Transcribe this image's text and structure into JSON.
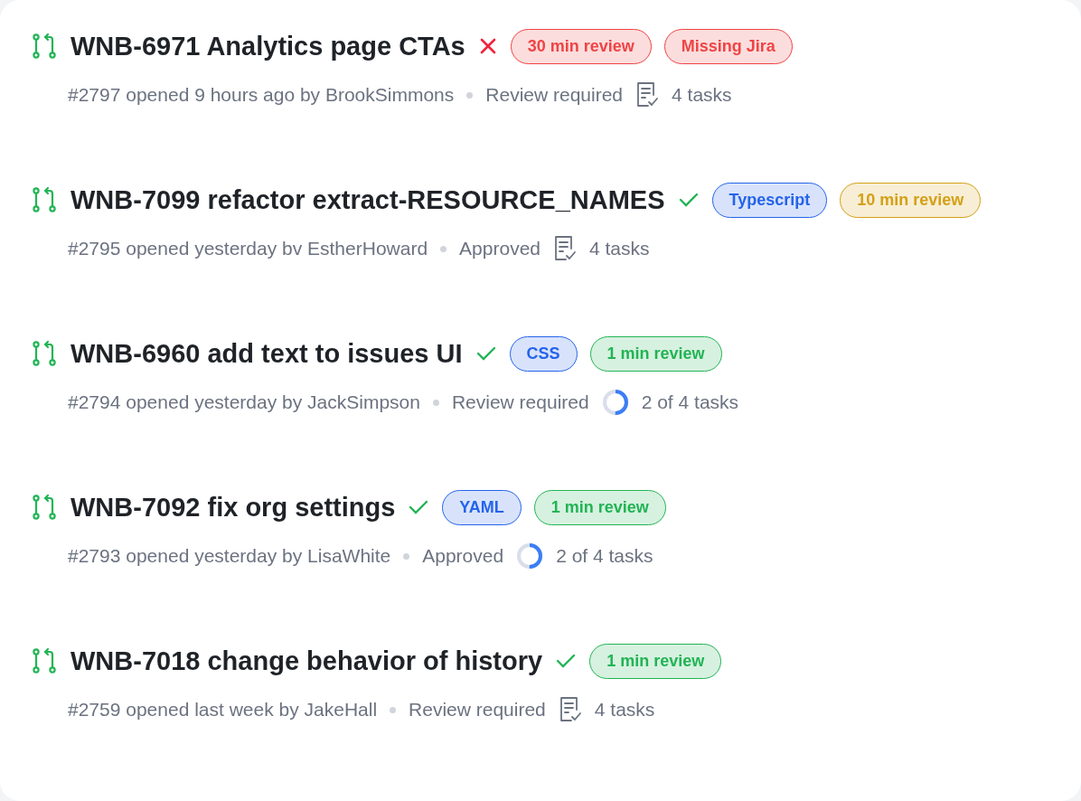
{
  "pull_requests": [
    {
      "title": "WNB-6971 Analytics page CTAs",
      "passed": false,
      "tags": [
        {
          "label": "30 min review",
          "color": "#ef4444"
        },
        {
          "label": "Missing Jira",
          "color": "#ef4444"
        }
      ],
      "meta": "#2797 opened 9 hours ago by BrookSimmons",
      "review": "Review required",
      "tasks": {
        "kind": "list",
        "label": "4 tasks"
      }
    },
    {
      "title": "WNB-7099 refactor extract-RESOURCE_NAMES",
      "passed": true,
      "tags": [
        {
          "label": "Typescript",
          "color": "#2563eb"
        },
        {
          "label": "10 min review",
          "color": "#d4a017"
        }
      ],
      "meta": "#2795 opened yesterday bv  EstherHoward",
      "review": "Approved",
      "tasks": {
        "kind": "list",
        "label": "4 tasks"
      }
    },
    {
      "title": "WNB-6960 add text to issues UI",
      "passed": true,
      "tags": [
        {
          "label": "CSS",
          "color": "#2563eb"
        },
        {
          "label": "1 min review",
          "color": "#22b455"
        }
      ],
      "meta": "#2794 opened yesterday by JackSimpson",
      "review": "Review required",
      "tasks": {
        "kind": "progress",
        "label": "2 of 4 tasks"
      }
    },
    {
      "title": "WNB-7092 fix org settings",
      "passed": true,
      "tags": [
        {
          "label": "YAML",
          "color": "#2563eb"
        },
        {
          "label": "1 min review",
          "color": "#22b455"
        }
      ],
      "meta": "#2793 opened yesterday by LisaWhite",
      "review": "Approved",
      "tasks": {
        "kind": "progress",
        "label": "2 of 4 tasks"
      }
    },
    {
      "title": "WNB-7018 change behavior of history",
      "passed": true,
      "tags": [
        {
          "label": "1 min review",
          "color": "#22b455"
        }
      ],
      "meta": "#2759 opened last week by JakeHall",
      "review": "Review required",
      "tasks": {
        "kind": "list",
        "label": "4 tasks"
      }
    }
  ]
}
